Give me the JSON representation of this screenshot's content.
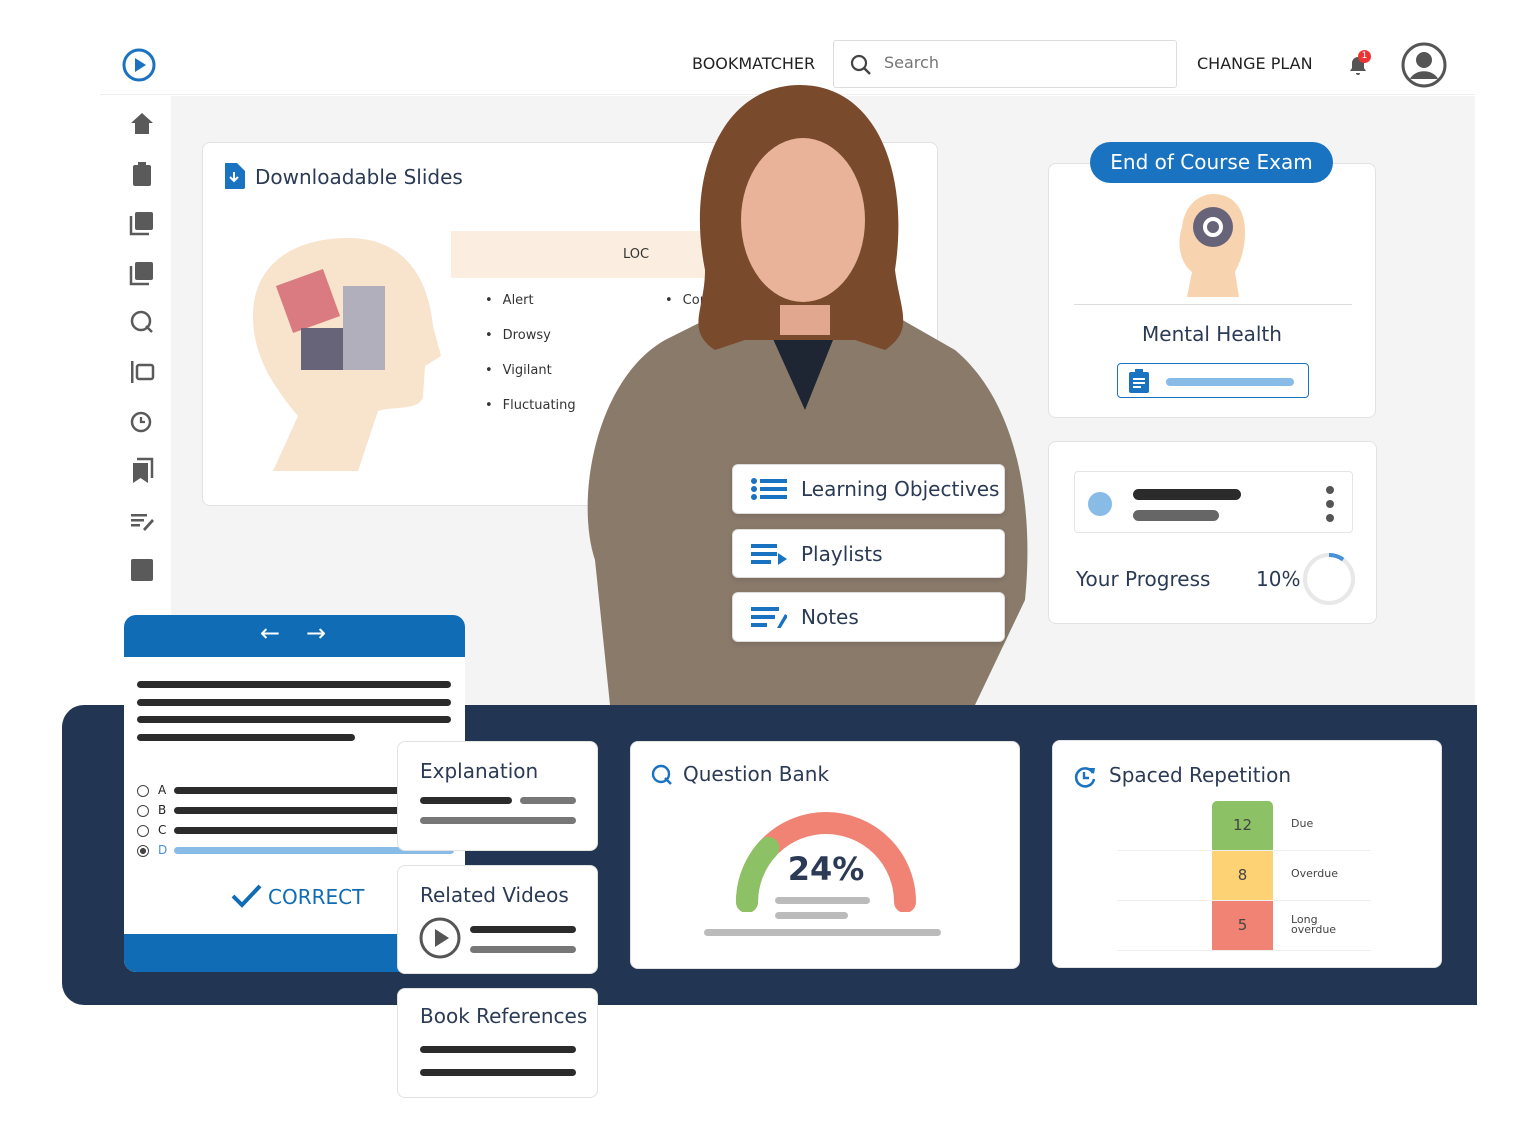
{
  "header": {
    "bookmatcher": "BOOKMATCHER",
    "search_placeholder": "Search",
    "change_plan": "CHANGE PLAN",
    "notification_count": "1"
  },
  "sidebar": [
    "home-icon",
    "clipboard-icon",
    "video-library-icon",
    "library-icon",
    "question-icon",
    "list-icon",
    "repeat-clock-icon",
    "bookmarks-icon",
    "notes-icon",
    "chart-icon"
  ],
  "slides": {
    "title": "Downloadable Slides",
    "table_header": "LOC",
    "items": [
      "Alert",
      "Drowsy",
      "Vigilant",
      "Fluctuating"
    ],
    "col2_partial": "Con"
  },
  "menu": {
    "learning_objectives": "Learning Objectives",
    "playlists": "Playlists",
    "notes": "Notes"
  },
  "exam": {
    "badge": "End of Course Exam",
    "topic": "Mental Health"
  },
  "progress": {
    "label": "Your Progress",
    "value_text": "10%",
    "value": 10
  },
  "quiz": {
    "options": [
      "A",
      "B",
      "C",
      "D"
    ],
    "selected": "D",
    "result": "CORRECT"
  },
  "explanation": {
    "title": "Explanation"
  },
  "related_videos": {
    "title": "Related Videos"
  },
  "book_references": {
    "title": "Book References"
  },
  "question_bank": {
    "title": "Question Bank",
    "value_text": "24%",
    "value": 24
  },
  "spaced_repetition": {
    "title": "Spaced Repetition",
    "rows": [
      {
        "count": "12",
        "label": "Due",
        "color": "#8cc265"
      },
      {
        "count": "8",
        "label": "Overdue",
        "color": "#fdd274"
      },
      {
        "count": "5",
        "label": "Long overdue",
        "color": "#f08373"
      }
    ]
  },
  "colors": {
    "primary": "#1a73c0",
    "dark_band": "#223553"
  }
}
